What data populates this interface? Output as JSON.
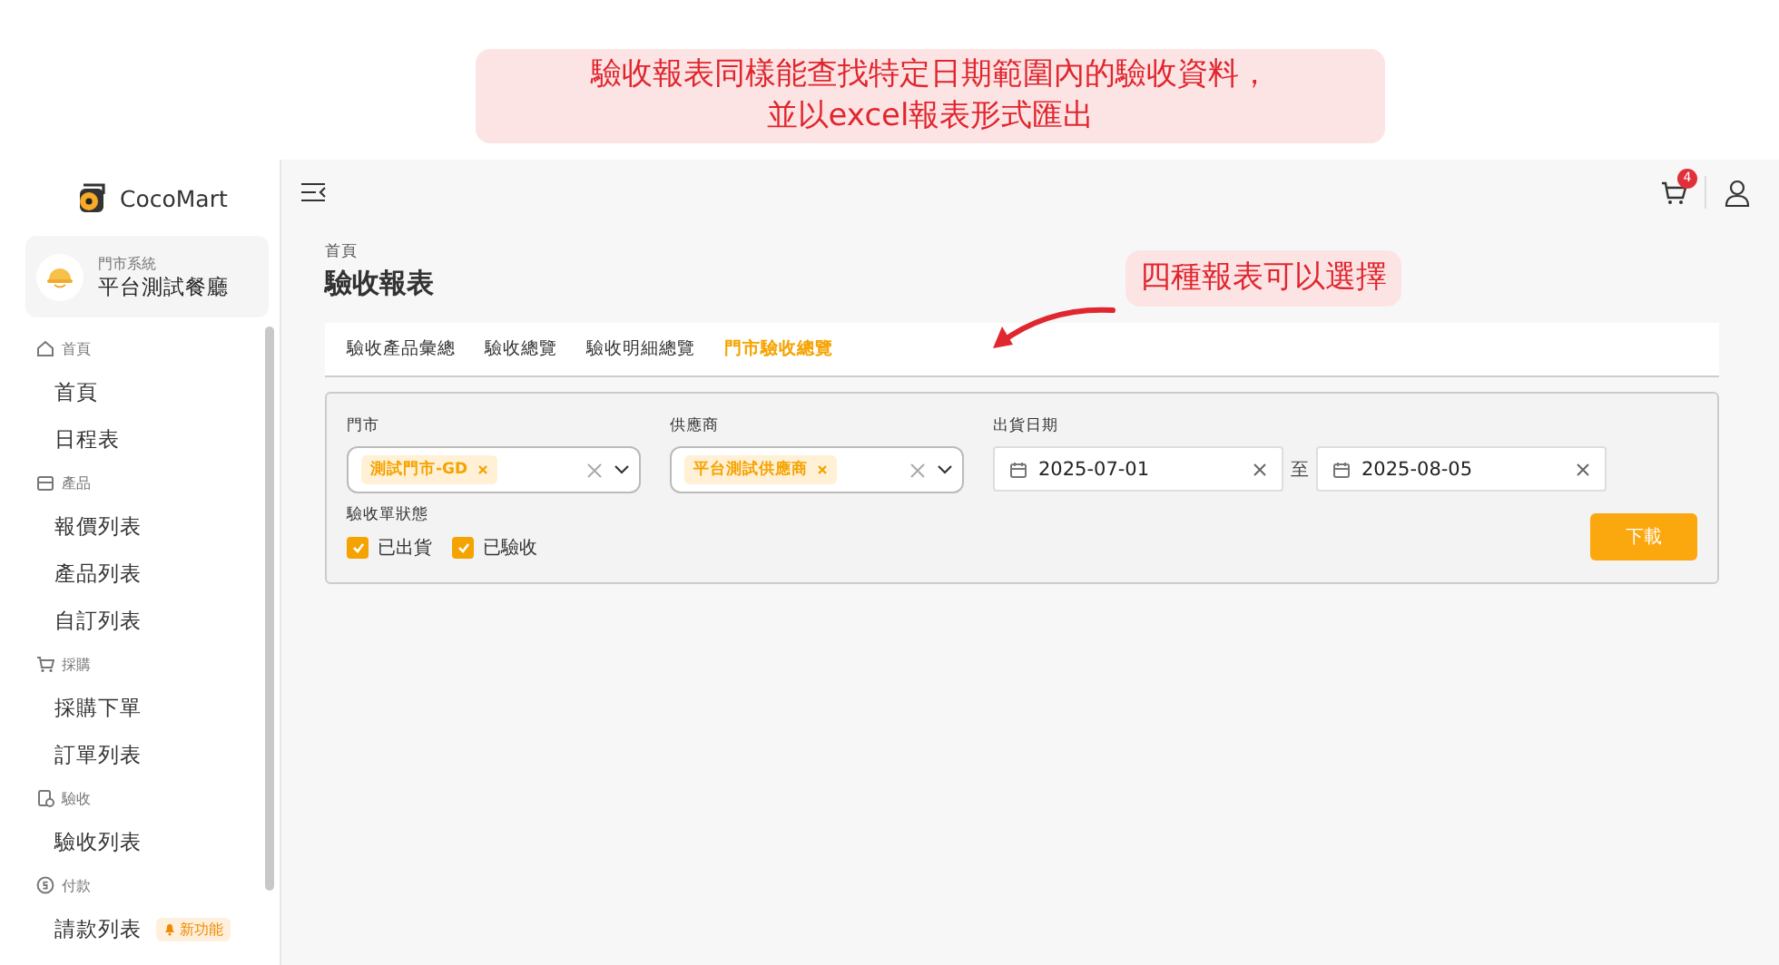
{
  "annotations": [
    {
      "kind": "note",
      "lines": [
        "驗收報表同樣能查找特定日期範圍內的驗收資料，",
        "並以excel報表形式匯出"
      ]
    },
    {
      "kind": "pointer",
      "text": "四種報表可以選擇"
    }
  ],
  "sidebar": {
    "logo": "CocoMart",
    "store": {
      "system": "門市系統",
      "name": "平台測試餐廳"
    },
    "sections": [
      {
        "label": "首頁",
        "items": [
          {
            "label": "首頁",
            "selected": false
          },
          {
            "label": "日程表",
            "selected": false
          }
        ]
      },
      {
        "label": "產品",
        "items": [
          {
            "label": "報價列表",
            "selected": false
          },
          {
            "label": "產品列表",
            "selected": false
          },
          {
            "label": "自訂列表",
            "selected": false
          }
        ]
      },
      {
        "label": "採購",
        "items": [
          {
            "label": "採購下單",
            "selected": false
          },
          {
            "label": "訂單列表",
            "selected": false
          }
        ]
      },
      {
        "label": "驗收",
        "items": [
          {
            "label": "驗收列表",
            "selected": false
          }
        ]
      },
      {
        "label": "付款",
        "items": [
          {
            "label": "請款列表",
            "selected": false,
            "badge": "新功能"
          }
        ]
      }
    ]
  },
  "header": {
    "cart_count": "4"
  },
  "breadcrumb": "首頁",
  "title": "驗收報表",
  "tabs": [
    {
      "label": "驗收產品彙總",
      "selected": false
    },
    {
      "label": "驗收總覽",
      "selected": false
    },
    {
      "label": "驗收明細總覽",
      "selected": false
    },
    {
      "label": "門市驗收總覽",
      "selected": true
    }
  ],
  "filters": {
    "store": {
      "label": "門市",
      "tags": [
        "測試門市-GD"
      ]
    },
    "supplier": {
      "label": "供應商",
      "tags": [
        "平台測試供應商"
      ]
    },
    "date": {
      "label": "出貨日期",
      "from": "2025-07-01",
      "separator": "至",
      "to": "2025-08-05"
    },
    "status": {
      "label": "驗收單狀態",
      "options": [
        {
          "label": "已出貨",
          "checked": true
        },
        {
          "label": "已驗收",
          "checked": true
        }
      ]
    },
    "download": "下載"
  }
}
